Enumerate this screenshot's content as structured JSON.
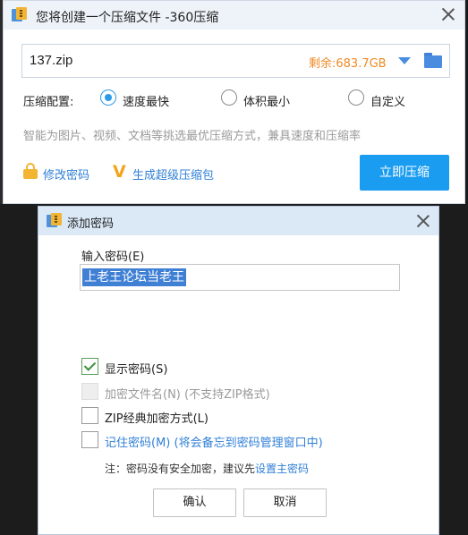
{
  "main_window": {
    "title": "您将创建一个压缩文件 -360压缩",
    "path": "137.zip",
    "free_space": "剩余:683.7GB",
    "config_label": "压缩配置:",
    "options": [
      "速度最快",
      "体积最小",
      "自定义"
    ],
    "selected_option": "速度最快",
    "hint": "智能为图片、视频、文档等挑选最优压缩方式，兼具速度和压缩率",
    "change_password_link": "修改密码",
    "super_package_link": "生成超级压缩包",
    "compress_button": "立即压缩"
  },
  "dialog": {
    "title": "添加密码",
    "password_label": "输入密码(E)",
    "password_value": "上老王论坛当老王",
    "checkboxes": [
      {
        "label": "显示密码(S)",
        "checked": true,
        "enabled": true
      },
      {
        "label": "加密文件名(N) (不支持ZIP格式)",
        "checked": false,
        "enabled": false
      },
      {
        "label": "ZIP经典加密方式(L)",
        "checked": false,
        "enabled": true
      },
      {
        "label": "记住密码(M) (将会备忘到密码管理窗口中)",
        "checked": false,
        "enabled": true
      }
    ],
    "note_prefix": "注：密码没有安全加密，建议先",
    "note_link": "设置主密码",
    "ok_button": "确认",
    "cancel_button": "取消"
  },
  "colors": {
    "accent": "#1a9cf0",
    "link": "#2f7fd6",
    "free_space": "#f08a24",
    "icon_gold": "#f2b433"
  }
}
